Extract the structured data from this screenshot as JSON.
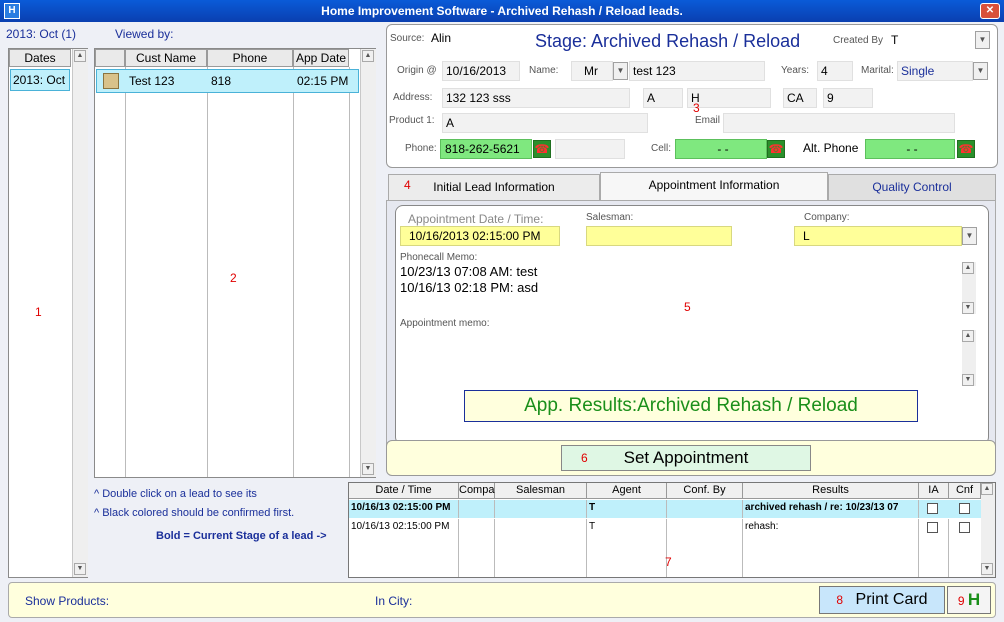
{
  "window": {
    "title": "Home Improvement Software - Archived Rehash / Reload leads."
  },
  "left": {
    "header": "2013: Oct (1)",
    "viewed_by": "Viewed by:",
    "dates_col": "Dates",
    "dates": [
      "2013: Oct"
    ],
    "marker": "1"
  },
  "leads": {
    "cols": [
      "Cust Name",
      "Phone",
      "App Date"
    ],
    "rows": [
      {
        "name": "Test 123",
        "phone": "818",
        "app_date": "02:15 PM"
      }
    ],
    "marker": "2",
    "hint1": "^ Double click on a lead to see its",
    "hint2": "^ Black colored should be confirmed first.",
    "bold_note": "Bold = Current Stage of a lead  ->"
  },
  "info": {
    "source_label": "Source:",
    "source": "Alin",
    "stage": "Stage: Archived Rehash / Reload",
    "created_by_label": "Created By",
    "created_by": "T",
    "origin_label": "Origin @",
    "origin": "10/16/2013",
    "name_label": "Name:",
    "title": "Mr",
    "name": "test 123",
    "years_label": "Years:",
    "years": "4",
    "marital_label": "Marital:",
    "marital": "Single",
    "address_label": "Address:",
    "address": "132 123 sss",
    "addr2": "A",
    "addr3": "H",
    "marker": "3",
    "state": "CA",
    "zip": "9",
    "product_label": "Product 1:",
    "product": "A",
    "email_label": "Email",
    "email": "",
    "phone_label": "Phone:",
    "phone": "818-262-5621",
    "cell_label": "Cell:",
    "cell": "-  -",
    "alt_label": "Alt. Phone",
    "alt": "-  -"
  },
  "tabs": {
    "marker": "4",
    "items": [
      "Initial Lead Information",
      "Appointment Information",
      "Quality Control"
    ]
  },
  "appt": {
    "date_label": "Appointment Date / Time:",
    "date": "10/16/2013 02:15:00 PM",
    "salesman_label": "Salesman:",
    "salesman": "",
    "company_label": "Company:",
    "company": "L",
    "memo_label": "Phonecall Memo:",
    "memo_lines": [
      "10/23/13 07:08 AM: test",
      "10/16/13 02:18 PM: asd"
    ],
    "marker": "5",
    "appt_memo_label": "Appointment memo:",
    "results": "App. Results:Archived Rehash / Reload"
  },
  "set_appt": {
    "marker": "6",
    "label": "Set Appointment"
  },
  "history": {
    "cols": [
      "Date / Time",
      "Compa",
      "Salesman",
      "Agent",
      "Conf. By",
      "Results",
      "IA",
      "Cnf"
    ],
    "rows": [
      {
        "date": "10/16/13 02:15:00 PM",
        "agent": "T",
        "results": "archived rehash / re: 10/23/13 07"
      },
      {
        "date": "10/16/13 02:15:00 PM",
        "agent": "T",
        "results": "rehash:"
      }
    ],
    "marker": "7"
  },
  "footer": {
    "show_products": "Show Products:",
    "in_city": "In City:",
    "print_marker": "8",
    "print_label": "Print Card",
    "h_marker": "9",
    "h_label": "H"
  },
  "colors": {
    "accent": "#1a2f9a",
    "stage": "#1a2f9a",
    "results": "#1a8f1a",
    "green_field": "#7fe87f",
    "yellow_field": "#ffff99"
  }
}
